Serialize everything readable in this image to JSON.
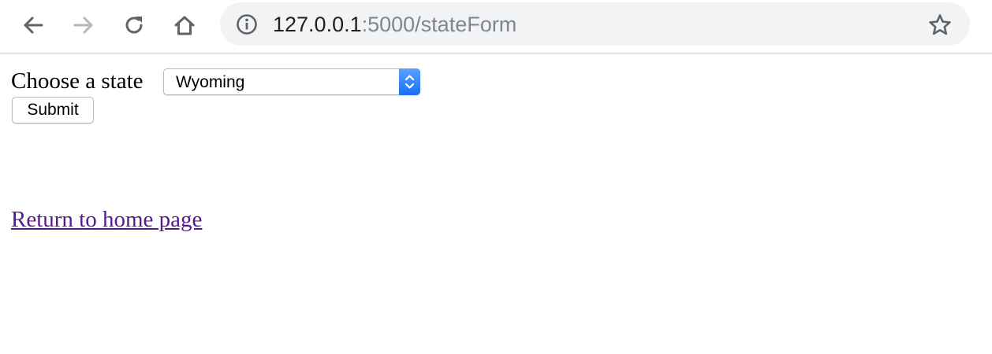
{
  "browser": {
    "url_host": "127.0.0.1",
    "url_path": ":5000/stateForm",
    "icons": {
      "back": "back-arrow-icon",
      "forward": "forward-arrow-icon",
      "reload": "reload-icon",
      "home": "home-icon",
      "info": "info-icon",
      "bookmark": "star-icon"
    }
  },
  "form": {
    "label": "Choose a state",
    "selected_state": "Wyoming",
    "submit_label": "Submit"
  },
  "links": {
    "home": "Return to home page"
  },
  "colors": {
    "visited_link": "#551a8b",
    "select_accent": "#1a6ef5",
    "omnibox_bg": "#f1f3f4"
  }
}
